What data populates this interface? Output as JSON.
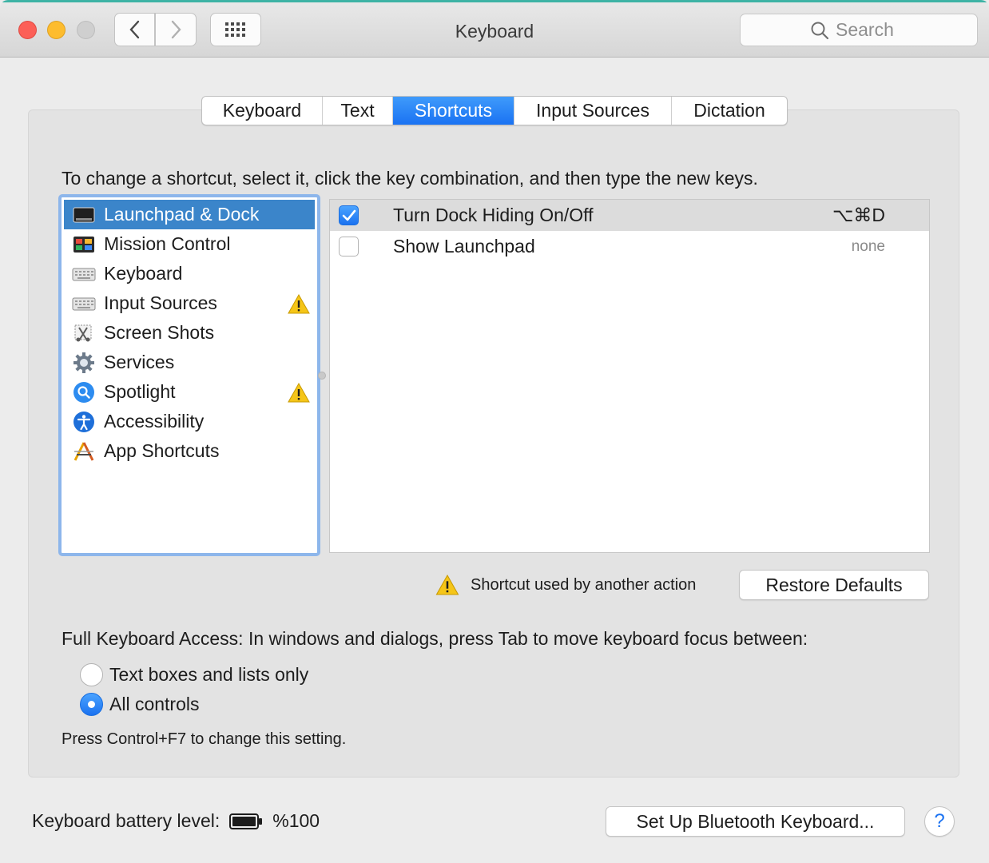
{
  "window": {
    "title": "Keyboard"
  },
  "search": {
    "placeholder": "Search"
  },
  "tabs": [
    {
      "label": "Keyboard",
      "active": false
    },
    {
      "label": "Text",
      "active": false
    },
    {
      "label": "Shortcuts",
      "active": true
    },
    {
      "label": "Input Sources",
      "active": false
    },
    {
      "label": "Dictation",
      "active": false
    }
  ],
  "instruction": "To change a shortcut, select it, click the key combination, and then type the new keys.",
  "categories": [
    {
      "label": "Launchpad & Dock",
      "icon": "launchpad-dock-icon",
      "selected": true,
      "warning": false
    },
    {
      "label": "Mission Control",
      "icon": "mission-control-icon",
      "selected": false,
      "warning": false
    },
    {
      "label": "Keyboard",
      "icon": "keyboard-icon",
      "selected": false,
      "warning": false
    },
    {
      "label": "Input Sources",
      "icon": "keyboard-icon",
      "selected": false,
      "warning": true
    },
    {
      "label": "Screen Shots",
      "icon": "screenshot-icon",
      "selected": false,
      "warning": false
    },
    {
      "label": "Services",
      "icon": "gear-icon",
      "selected": false,
      "warning": false
    },
    {
      "label": "Spotlight",
      "icon": "spotlight-icon",
      "selected": false,
      "warning": true
    },
    {
      "label": "Accessibility",
      "icon": "accessibility-icon",
      "selected": false,
      "warning": false
    },
    {
      "label": "App Shortcuts",
      "icon": "app-shortcuts-icon",
      "selected": false,
      "warning": false
    }
  ],
  "shortcuts": [
    {
      "label": "Turn Dock Hiding On/Off",
      "key": "⌥⌘D",
      "checked": true
    },
    {
      "label": "Show Launchpad",
      "key": "none",
      "checked": false
    }
  ],
  "legend": "Shortcut used by another action",
  "buttons": {
    "restore_defaults": "Restore Defaults",
    "bluetooth": "Set Up Bluetooth Keyboard...",
    "help": "?"
  },
  "full_keyboard_access": {
    "label": "Full Keyboard Access: In windows and dialogs, press Tab to move keyboard focus between:",
    "options": [
      {
        "label": "Text boxes and lists only",
        "selected": false
      },
      {
        "label": "All controls",
        "selected": true
      }
    ],
    "note": "Press Control+F7 to change this setting."
  },
  "battery": {
    "label": "Keyboard battery level:",
    "value": "%100",
    "level": 1.0
  },
  "colors": {
    "accent": "#1a72f2",
    "selection": "#3b85ca",
    "close": "#fc5f57",
    "minimize": "#fdbc2e",
    "warning": "#f5c518"
  }
}
